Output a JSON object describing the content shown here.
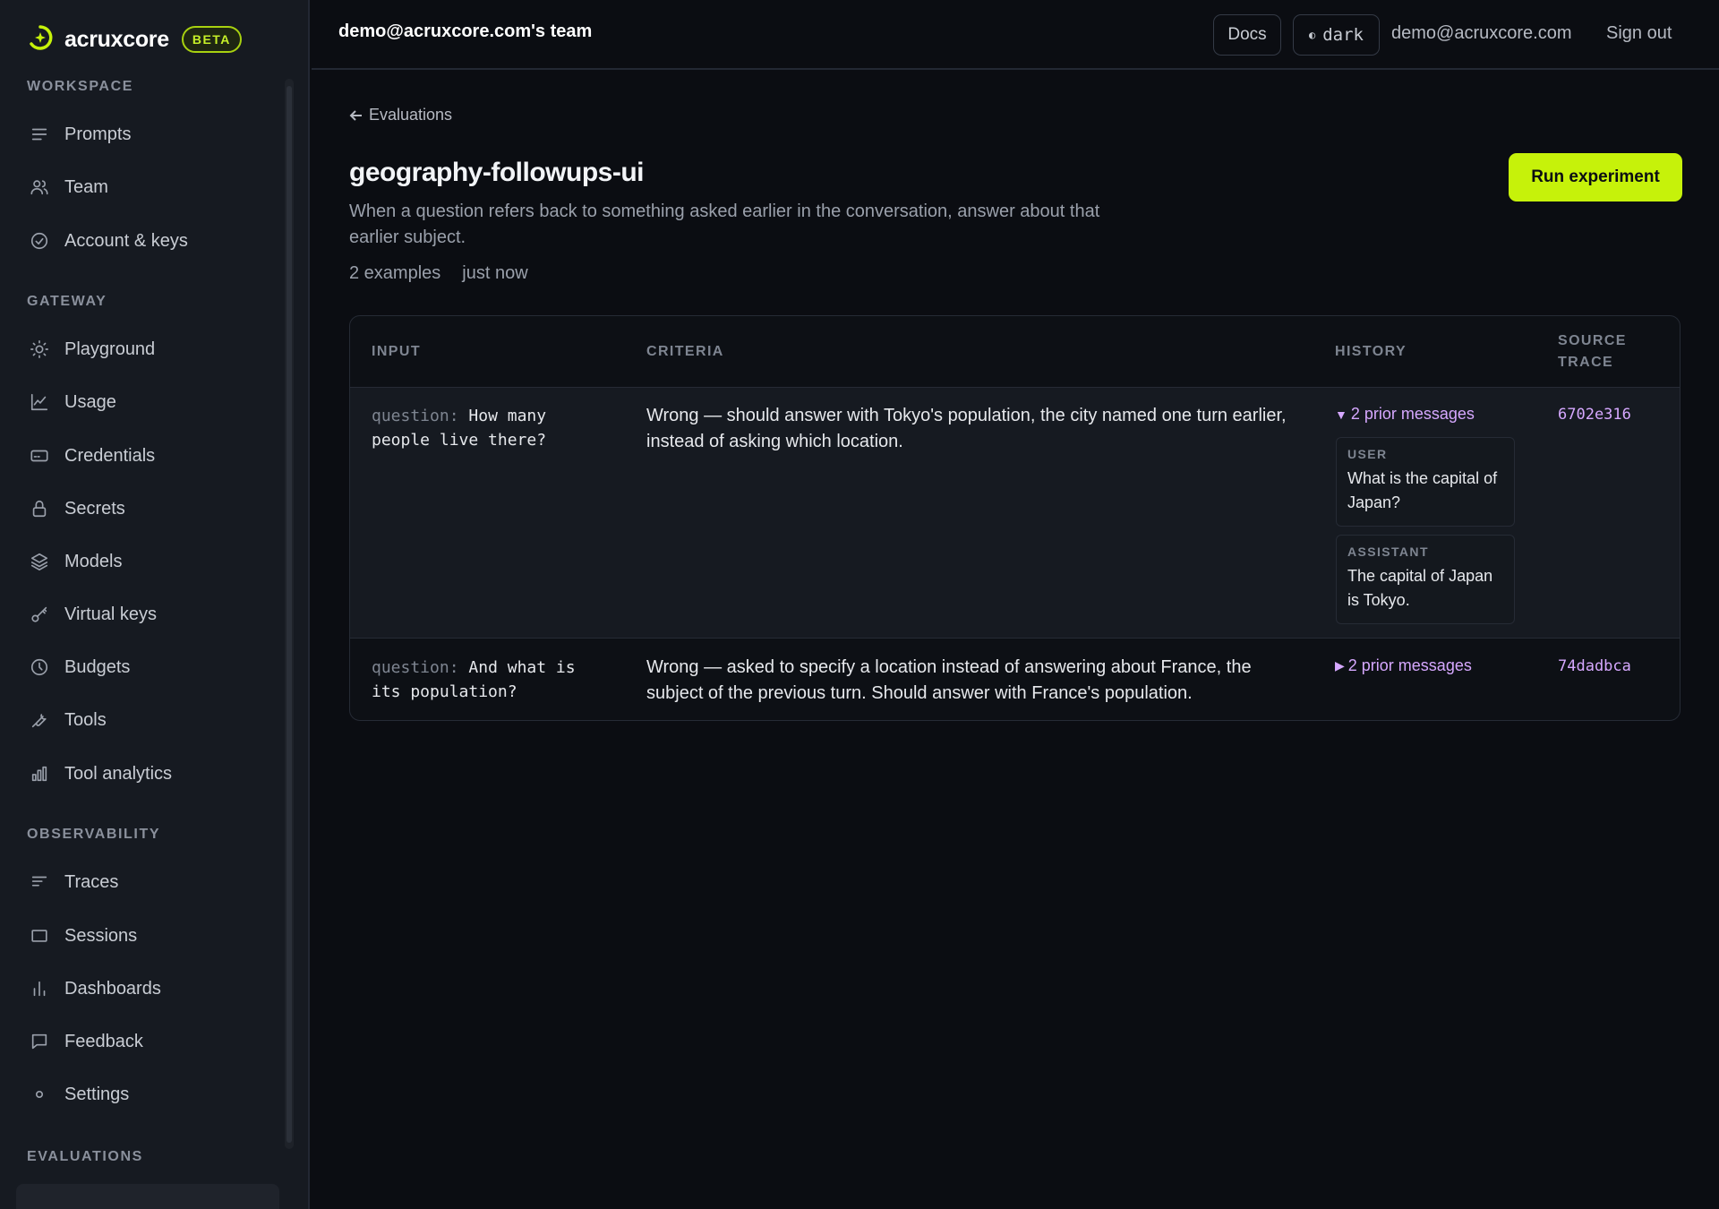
{
  "brand": {
    "name": "acruxcore",
    "badge": "BETA",
    "accent": "#c6f20a"
  },
  "sidebar": {
    "sections": [
      {
        "title": "WORKSPACE",
        "items": [
          {
            "label": "Prompts",
            "icon": "lines-icon"
          },
          {
            "label": "Team",
            "icon": "users-icon"
          },
          {
            "label": "Account & keys",
            "icon": "check-circle-icon"
          }
        ]
      },
      {
        "title": "GATEWAY",
        "items": [
          {
            "label": "Playground",
            "icon": "sun-icon"
          },
          {
            "label": "Usage",
            "icon": "line-chart-icon"
          },
          {
            "label": "Credentials",
            "icon": "card-icon"
          },
          {
            "label": "Secrets",
            "icon": "lock-icon"
          },
          {
            "label": "Models",
            "icon": "layers-icon"
          },
          {
            "label": "Virtual keys",
            "icon": "key-icon"
          },
          {
            "label": "Budgets",
            "icon": "clock-icon"
          },
          {
            "label": "Tools",
            "icon": "wrench-icon"
          },
          {
            "label": "Tool analytics",
            "icon": "bar-chart-icon"
          }
        ]
      },
      {
        "title": "OBSERVABILITY",
        "items": [
          {
            "label": "Traces",
            "icon": "list-icon"
          },
          {
            "label": "Sessions",
            "icon": "square-icon"
          },
          {
            "label": "Dashboards",
            "icon": "bars-icon"
          },
          {
            "label": "Feedback",
            "icon": "message-icon"
          },
          {
            "label": "Settings",
            "icon": "dot-icon"
          }
        ]
      },
      {
        "title": "EVALUATIONS",
        "items": []
      }
    ]
  },
  "header": {
    "team": "demo@acruxcore.com's team",
    "docs_label": "Docs",
    "theme_label": "dark",
    "user_email": "demo@acruxcore.com",
    "signout_label": "Sign out"
  },
  "page": {
    "back_label": "Evaluations",
    "title": "geography-followups-ui",
    "description": "When a question refers back to something asked earlier in the conversation, answer about that earlier subject.",
    "examples_count": "2 examples",
    "updated": "just now",
    "run_label": "Run experiment"
  },
  "table": {
    "columns": [
      "INPUT",
      "CRITERIA",
      "HISTORY",
      "SOURCE",
      "TRACE"
    ],
    "rows": [
      {
        "input_key": "question:",
        "input_value": "How many people live there?",
        "criteria": "Wrong — should answer with Tokyo's population, the city named one turn earlier, instead of asking which location.",
        "history_toggle": "▼",
        "history_label": "2 prior messages",
        "messages": [
          {
            "role": "USER",
            "text": "What is the capital of Japan?"
          },
          {
            "role": "ASSISTANT",
            "text": "The capital of Japan is Tokyo."
          }
        ],
        "trace": "6702e316"
      },
      {
        "input_key": "question:",
        "input_value": "And what is its population?",
        "criteria": "Wrong — asked to specify a location instead of answering about France, the subject of the previous turn. Should answer with France's population.",
        "history_toggle": "▶",
        "history_label": "2 prior messages",
        "trace": "74dadbca"
      }
    ]
  }
}
